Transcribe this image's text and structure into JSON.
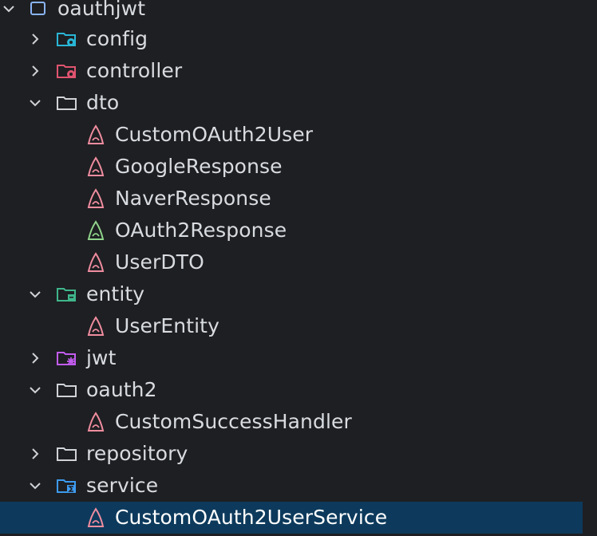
{
  "tree": {
    "root": {
      "label": "oauthjwt",
      "icon": "package-icon",
      "expanded": true
    },
    "config": {
      "label": "config",
      "icon": "config-folder-icon",
      "expanded": false,
      "color": "#29b6d6"
    },
    "controller": {
      "label": "controller",
      "icon": "controller-folder-icon",
      "expanded": false,
      "color": "#e05470"
    },
    "dto": {
      "label": "dto",
      "icon": "folder-icon",
      "expanded": true,
      "children": [
        {
          "label": "CustomOAuth2User",
          "icon": "java-class-icon"
        },
        {
          "label": "GoogleResponse",
          "icon": "java-class-icon"
        },
        {
          "label": "NaverResponse",
          "icon": "java-class-icon"
        },
        {
          "label": "OAuth2Response",
          "icon": "java-interface-icon"
        },
        {
          "label": "UserDTO",
          "icon": "java-class-icon"
        }
      ]
    },
    "entity": {
      "label": "entity",
      "icon": "entity-folder-icon",
      "expanded": true,
      "color": "#3fb68b",
      "children": [
        {
          "label": "UserEntity",
          "icon": "java-class-icon"
        }
      ]
    },
    "jwt": {
      "label": "jwt",
      "icon": "jwt-folder-icon",
      "expanded": false,
      "color": "#c35cf0"
    },
    "oauth2": {
      "label": "oauth2",
      "icon": "folder-icon",
      "expanded": true,
      "children": [
        {
          "label": "CustomSuccessHandler",
          "icon": "java-class-icon"
        }
      ]
    },
    "repository": {
      "label": "repository",
      "icon": "folder-icon",
      "expanded": false
    },
    "service": {
      "label": "service",
      "icon": "service-folder-icon",
      "expanded": true,
      "color": "#3d9bef",
      "children": [
        {
          "label": "CustomOAuth2UserService",
          "icon": "java-class-icon",
          "selected": true
        }
      ]
    }
  },
  "colors": {
    "background": "#1e1f22",
    "selection": "#0d3a5c",
    "text": "#d8dbe0",
    "class_icon": "#f08da0",
    "interface_icon": "#8fd48a"
  }
}
